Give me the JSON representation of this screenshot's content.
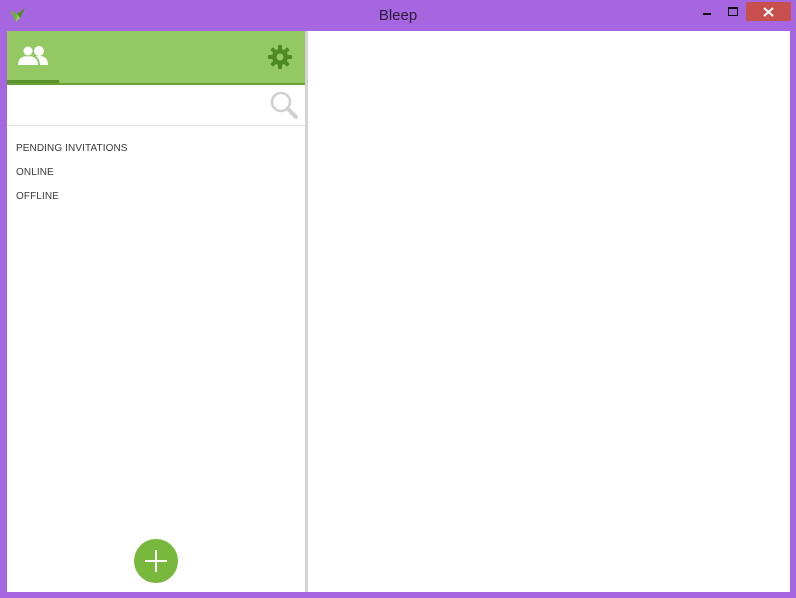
{
  "window": {
    "title": "Bleep",
    "controls": [
      "minimize-icon",
      "maximize-icon",
      "close-icon"
    ],
    "frame_color": "#a566e0",
    "close_color": "#c7504e"
  },
  "sidebar": {
    "header_color": "#93c863",
    "tabs": [
      {
        "icon": "contacts-icon",
        "active": true
      }
    ],
    "settings_icon": "gear-icon",
    "search": {
      "value": "",
      "placeholder": "",
      "icon": "search-icon"
    },
    "groups": [
      {
        "label": "PENDING INVITATIONS"
      },
      {
        "label": "ONLINE"
      },
      {
        "label": "OFFLINE"
      }
    ],
    "add_button": {
      "icon": "plus-icon",
      "color": "#78b83c"
    }
  }
}
